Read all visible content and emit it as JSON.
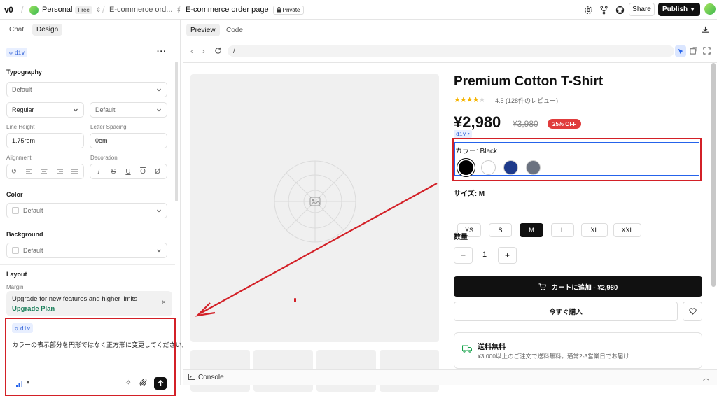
{
  "topbar": {
    "logo": "v0",
    "workspace": "Personal",
    "plan_badge": "Free",
    "project_short": "E-commerce ord...",
    "page_title": "E-commerce order page",
    "privacy": "Private",
    "share_label": "Share",
    "publish_label": "Publish"
  },
  "left_panel": {
    "tabs": [
      "Chat",
      "Design"
    ],
    "selected_element": "div",
    "typography": {
      "title": "Typography",
      "font_family": "Default",
      "font_weight": "Regular",
      "font_size": "Default",
      "line_height_label": "Line Height",
      "line_height": "1.75rem",
      "letter_spacing_label": "Letter Spacing",
      "letter_spacing": "0em",
      "alignment_label": "Alignment",
      "decoration_label": "Decoration"
    },
    "color": {
      "title": "Color",
      "value": "Default"
    },
    "background": {
      "title": "Background",
      "value": "Default"
    },
    "layout": {
      "title": "Layout",
      "margin_label": "Margin"
    },
    "upgrade": {
      "text": "Upgrade for new features and higher limits",
      "link": "Upgrade Plan"
    },
    "chat_input": {
      "tag": "div",
      "text": "カラーの表示部分を円形ではなく正方形に変更してください。"
    }
  },
  "preview": {
    "tabs": [
      "Preview",
      "Code"
    ],
    "url": "/",
    "product": {
      "title": "Premium Cotton T-Shirt",
      "rating": 4.5,
      "rating_text": "4.5 (128件のレビュー)",
      "price": "¥2,980",
      "old_price": "¥3,980",
      "discount": "25% OFF",
      "div_tag": "div",
      "color_label": "カラー: Black",
      "swatches": [
        "#000000",
        "#ffffff",
        "#1e3a8a",
        "#6b7280"
      ],
      "size_label": "サイズ: M",
      "sizes": [
        "XS",
        "S",
        "M",
        "L",
        "XL",
        "XXL"
      ],
      "selected_size": "M",
      "qty_label": "数量",
      "qty": "1",
      "minus": "−",
      "plus": "+",
      "add_to_cart": "カートに追加 - ¥2,980",
      "buy_now": "今すぐ購入",
      "shipping_title": "送料無料",
      "shipping_text": "¥3,000以上のご注文で送料無料。通常2-3営業日でお届け"
    },
    "console_label": "Console"
  },
  "colors": {
    "annotation_red": "#d32027",
    "accent_blue": "#2563eb",
    "discount_red": "#e03c3c",
    "star_yellow": "#f5b400"
  }
}
